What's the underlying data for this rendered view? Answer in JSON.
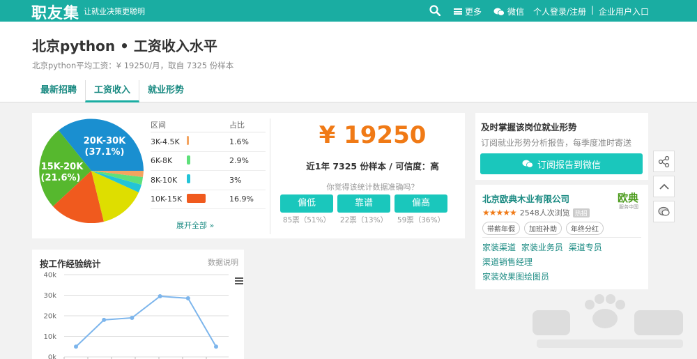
{
  "topbar": {
    "logo": "职友集",
    "slogan": "让就业决策更聪明",
    "more_label": "更多",
    "wechat_label": "微信",
    "login_label": "个人登录/注册",
    "separator": "|",
    "company_login_label": "企业用户入口"
  },
  "header": {
    "title": "北京python • 工资收入水平",
    "subtitle": "北京python平均工资：¥ 19250/月，取自 7325 份样本",
    "tabs": [
      {
        "label": "最新招聘",
        "active": false
      },
      {
        "label": "工资收入",
        "active": true
      },
      {
        "label": "就业形势",
        "active": false
      }
    ]
  },
  "salary_distribution": {
    "columns": [
      "区间",
      "",
      "占比"
    ],
    "rows": [
      {
        "range": "3K-4.5K",
        "pct": "1.6%",
        "value": 1.6,
        "color": "#f4a460"
      },
      {
        "range": "6K-8K",
        "pct": "2.9%",
        "value": 2.9,
        "color": "#5ee07a"
      },
      {
        "range": "8K-10K",
        "pct": "3%",
        "value": 3.0,
        "color": "#22c4d8"
      },
      {
        "range": "10K-15K",
        "pct": "16.9%",
        "value": 16.9,
        "color": "#f05a1e"
      }
    ],
    "expand_label": "展开全部 »"
  },
  "pie": {
    "labels": [
      {
        "text": "20K-30K",
        "pct": "(37.1%)"
      },
      {
        "text": "15K-20K",
        "pct": "(21.6%)"
      }
    ]
  },
  "summary": {
    "salary": "¥ 19250",
    "sample_line": "近1年 7325 份样本 / 可信度：高",
    "question": "你觉得该统计数据准确吗？",
    "votes": [
      {
        "label": "偏低",
        "count": "85票（51%）"
      },
      {
        "label": "靠谱",
        "count": "22票（13%）"
      },
      {
        "label": "偏高",
        "count": "59票（36%）"
      }
    ]
  },
  "experience": {
    "title": "按工作经验统计",
    "note": "数据说明"
  },
  "chart_data": {
    "type": "line",
    "title": "按工作经验统计",
    "y_ticks": [
      "40k",
      "30k",
      "20k",
      "10k",
      "0k"
    ],
    "ylim": [
      0,
      40000
    ],
    "x": [
      0,
      1,
      2,
      3,
      4,
      5
    ],
    "values": [
      5000,
      18000,
      19000,
      29500,
      28500,
      5000
    ],
    "color": "#7cb5ec",
    "grid": true
  },
  "subscribe": {
    "title": "及时掌握该岗位就业形势",
    "desc": "订阅就业形势分析报告，每季度准时寄送",
    "button_label": "订阅报告到微信"
  },
  "company": {
    "name": "北京欧典木业有限公司",
    "logo_text": "欧典",
    "logo_sub": "服务中国",
    "stars": "★★★★★",
    "views": "2548人次浏览",
    "hot": "热招",
    "tags": [
      "带薪年假",
      "加班补助",
      "年终分红"
    ],
    "jobs": [
      [
        "家装渠道",
        "家装业务员",
        "渠道专员"
      ],
      [
        "渠道销售经理"
      ],
      [
        "家装效果图绘图员"
      ]
    ]
  },
  "colors": {
    "brand": "#1aada2",
    "button": "#1ac7bc",
    "salary": "#f07a16"
  }
}
